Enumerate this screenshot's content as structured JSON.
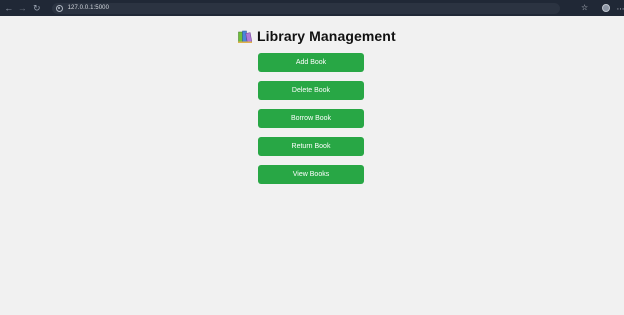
{
  "browser": {
    "url": "127.0.0.1:5000",
    "icons": {
      "back": "arrow-left-icon",
      "forward": "arrow-right-icon",
      "reload": "reload-icon",
      "site_info": "site-info-icon",
      "bookmark": "star-icon",
      "profile": "profile-icon",
      "menu": "more-vert-icon"
    }
  },
  "page": {
    "title": "Library Management",
    "title_icon": "books-icon",
    "buttons": {
      "add": "Add Book",
      "delete": "Delete Book",
      "borrow": "Borrow Book",
      "return": "Return Book",
      "view": "View Books"
    }
  },
  "colors": {
    "button_bg": "#28a745",
    "page_bg": "#f1f1f1",
    "browser_bar_bg": "#202836"
  }
}
